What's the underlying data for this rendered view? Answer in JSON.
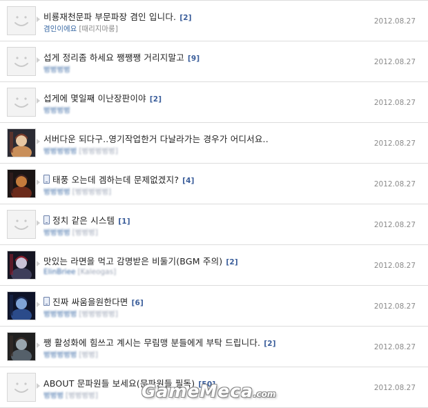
{
  "posts": [
    {
      "avatar": "default",
      "title": "비룡재천문파 부문파장 겸인 입니다.",
      "count": "[2]",
      "mobile": false,
      "nick": "겸인이에요",
      "group": "[때리지마룽]",
      "blurred": false,
      "date": "2012.08.27"
    },
    {
      "avatar": "default",
      "title": "섭게 정리좀 하세요 쨍쨍쨍 거리지말고",
      "count": "[9]",
      "mobile": false,
      "nick": "벙벙벙벙",
      "group": "",
      "blurred": true,
      "date": "2012.08.27"
    },
    {
      "avatar": "default",
      "title": "섭게에 몇일째 이난장판이야",
      "count": "[2]",
      "mobile": false,
      "nick": "벙벙벙벙",
      "group": "",
      "blurred": true,
      "date": "2012.08.27"
    },
    {
      "avatar": "girl",
      "title": "서버다운 되다구..영기작업한거 다날라가는 경우가 어디서요..",
      "count": "",
      "mobile": false,
      "nick": "벙벙벙벙벙",
      "group": "[벙벙벙벙벙]",
      "blurred": true,
      "date": "2012.08.27"
    },
    {
      "avatar": "dark",
      "title": "태풍 오는데 겜하는데 문제없겠지?",
      "count": "[4]",
      "mobile": true,
      "nick": "벙벙벙벙",
      "group": "[벙벙벙벙벙]",
      "blurred": true,
      "date": "2012.08.27"
    },
    {
      "avatar": "default",
      "title": "정치 같은 시스템",
      "count": "[1]",
      "mobile": true,
      "nick": "벙벙벙벙",
      "group": "[벙벙벙]",
      "blurred": true,
      "date": "2012.08.27"
    },
    {
      "avatar": "warrior",
      "title": "맛있는 라면을 먹고 감명받은 비둘기(BGM 주의)",
      "count": "[2]",
      "mobile": false,
      "nick": "ElinBriee",
      "group": "[Kaleogas]",
      "blurred": true,
      "date": "2012.08.27"
    },
    {
      "avatar": "blue",
      "title": "진짜 싸움을원한다면",
      "count": "[6]",
      "mobile": true,
      "nick": "벙벙벙벙벙",
      "group": "[벙벙벙벙벙]",
      "blurred": true,
      "date": "2012.08.27"
    },
    {
      "avatar": "knight",
      "title": "쨍 활성화에 힘쓰고 계시는 무림맹 분들에게 부탁 드립니다.",
      "count": "[2]",
      "mobile": false,
      "nick": "벙벙벙벙벙",
      "group": "[벙벙]",
      "blurred": true,
      "date": "2012.08.27"
    },
    {
      "avatar": "default",
      "title": "ABOUT 문파원들 보세요(문파원들 필독)",
      "count": "[50]",
      "mobile": false,
      "nick": "벙벙벙",
      "group": "[벙벙벙벙]",
      "blurred": true,
      "date": "2012.08.27"
    }
  ],
  "watermark": {
    "text": "GameMeca",
    "suffix": ".com"
  },
  "colors": {
    "count": "#3a5d9a",
    "nick": "#3b6aa5",
    "date": "#8a8a8a",
    "border": "#dcdcdc"
  }
}
